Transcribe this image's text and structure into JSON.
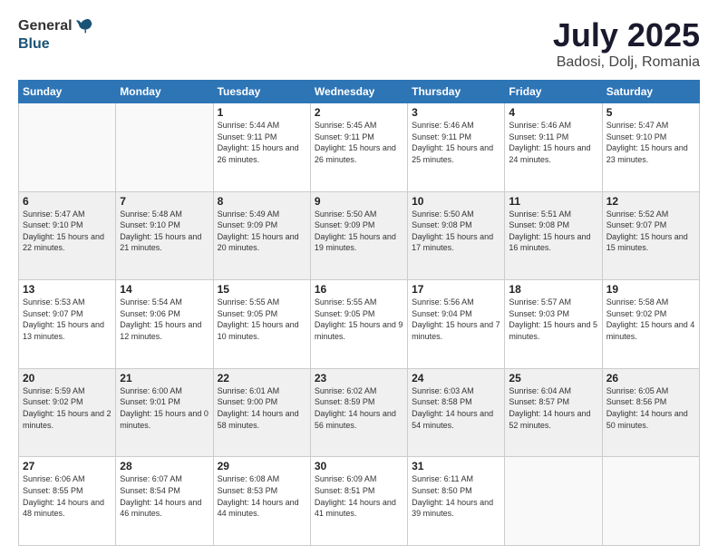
{
  "header": {
    "logo_general": "General",
    "logo_blue": "Blue",
    "month_title": "July 2025",
    "location": "Badosi, Dolj, Romania"
  },
  "weekdays": [
    "Sunday",
    "Monday",
    "Tuesday",
    "Wednesday",
    "Thursday",
    "Friday",
    "Saturday"
  ],
  "weeks": [
    [
      {
        "day": "",
        "info": ""
      },
      {
        "day": "",
        "info": ""
      },
      {
        "day": "1",
        "info": "Sunrise: 5:44 AM\nSunset: 9:11 PM\nDaylight: 15 hours\nand 26 minutes."
      },
      {
        "day": "2",
        "info": "Sunrise: 5:45 AM\nSunset: 9:11 PM\nDaylight: 15 hours\nand 26 minutes."
      },
      {
        "day": "3",
        "info": "Sunrise: 5:46 AM\nSunset: 9:11 PM\nDaylight: 15 hours\nand 25 minutes."
      },
      {
        "day": "4",
        "info": "Sunrise: 5:46 AM\nSunset: 9:11 PM\nDaylight: 15 hours\nand 24 minutes."
      },
      {
        "day": "5",
        "info": "Sunrise: 5:47 AM\nSunset: 9:10 PM\nDaylight: 15 hours\nand 23 minutes."
      }
    ],
    [
      {
        "day": "6",
        "info": "Sunrise: 5:47 AM\nSunset: 9:10 PM\nDaylight: 15 hours\nand 22 minutes."
      },
      {
        "day": "7",
        "info": "Sunrise: 5:48 AM\nSunset: 9:10 PM\nDaylight: 15 hours\nand 21 minutes."
      },
      {
        "day": "8",
        "info": "Sunrise: 5:49 AM\nSunset: 9:09 PM\nDaylight: 15 hours\nand 20 minutes."
      },
      {
        "day": "9",
        "info": "Sunrise: 5:50 AM\nSunset: 9:09 PM\nDaylight: 15 hours\nand 19 minutes."
      },
      {
        "day": "10",
        "info": "Sunrise: 5:50 AM\nSunset: 9:08 PM\nDaylight: 15 hours\nand 17 minutes."
      },
      {
        "day": "11",
        "info": "Sunrise: 5:51 AM\nSunset: 9:08 PM\nDaylight: 15 hours\nand 16 minutes."
      },
      {
        "day": "12",
        "info": "Sunrise: 5:52 AM\nSunset: 9:07 PM\nDaylight: 15 hours\nand 15 minutes."
      }
    ],
    [
      {
        "day": "13",
        "info": "Sunrise: 5:53 AM\nSunset: 9:07 PM\nDaylight: 15 hours\nand 13 minutes."
      },
      {
        "day": "14",
        "info": "Sunrise: 5:54 AM\nSunset: 9:06 PM\nDaylight: 15 hours\nand 12 minutes."
      },
      {
        "day": "15",
        "info": "Sunrise: 5:55 AM\nSunset: 9:05 PM\nDaylight: 15 hours\nand 10 minutes."
      },
      {
        "day": "16",
        "info": "Sunrise: 5:55 AM\nSunset: 9:05 PM\nDaylight: 15 hours\nand 9 minutes."
      },
      {
        "day": "17",
        "info": "Sunrise: 5:56 AM\nSunset: 9:04 PM\nDaylight: 15 hours\nand 7 minutes."
      },
      {
        "day": "18",
        "info": "Sunrise: 5:57 AM\nSunset: 9:03 PM\nDaylight: 15 hours\nand 5 minutes."
      },
      {
        "day": "19",
        "info": "Sunrise: 5:58 AM\nSunset: 9:02 PM\nDaylight: 15 hours\nand 4 minutes."
      }
    ],
    [
      {
        "day": "20",
        "info": "Sunrise: 5:59 AM\nSunset: 9:02 PM\nDaylight: 15 hours\nand 2 minutes."
      },
      {
        "day": "21",
        "info": "Sunrise: 6:00 AM\nSunset: 9:01 PM\nDaylight: 15 hours\nand 0 minutes."
      },
      {
        "day": "22",
        "info": "Sunrise: 6:01 AM\nSunset: 9:00 PM\nDaylight: 14 hours\nand 58 minutes."
      },
      {
        "day": "23",
        "info": "Sunrise: 6:02 AM\nSunset: 8:59 PM\nDaylight: 14 hours\nand 56 minutes."
      },
      {
        "day": "24",
        "info": "Sunrise: 6:03 AM\nSunset: 8:58 PM\nDaylight: 14 hours\nand 54 minutes."
      },
      {
        "day": "25",
        "info": "Sunrise: 6:04 AM\nSunset: 8:57 PM\nDaylight: 14 hours\nand 52 minutes."
      },
      {
        "day": "26",
        "info": "Sunrise: 6:05 AM\nSunset: 8:56 PM\nDaylight: 14 hours\nand 50 minutes."
      }
    ],
    [
      {
        "day": "27",
        "info": "Sunrise: 6:06 AM\nSunset: 8:55 PM\nDaylight: 14 hours\nand 48 minutes."
      },
      {
        "day": "28",
        "info": "Sunrise: 6:07 AM\nSunset: 8:54 PM\nDaylight: 14 hours\nand 46 minutes."
      },
      {
        "day": "29",
        "info": "Sunrise: 6:08 AM\nSunset: 8:53 PM\nDaylight: 14 hours\nand 44 minutes."
      },
      {
        "day": "30",
        "info": "Sunrise: 6:09 AM\nSunset: 8:51 PM\nDaylight: 14 hours\nand 41 minutes."
      },
      {
        "day": "31",
        "info": "Sunrise: 6:11 AM\nSunset: 8:50 PM\nDaylight: 14 hours\nand 39 minutes."
      },
      {
        "day": "",
        "info": ""
      },
      {
        "day": "",
        "info": ""
      }
    ]
  ]
}
